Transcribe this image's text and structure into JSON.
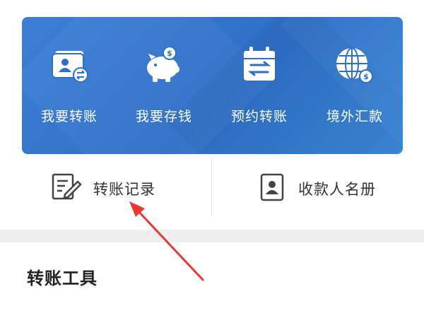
{
  "colors": {
    "banner_blue": "#2e6fc7",
    "text_dark": "#333333",
    "annotation_red": "#e53935"
  },
  "quick_actions": [
    {
      "label": "我要转账",
      "icon": "account-transfer-icon"
    },
    {
      "label": "我要存钱",
      "icon": "piggy-bank-icon"
    },
    {
      "label": "预约转账",
      "icon": "scheduled-transfer-icon"
    },
    {
      "label": "境外汇款",
      "icon": "global-remittance-icon"
    }
  ],
  "links": {
    "records": {
      "label": "转账记录",
      "icon": "edit-document-icon"
    },
    "payees": {
      "label": "收款人名册",
      "icon": "contact-card-icon"
    }
  },
  "section": {
    "title": "转账工具"
  }
}
